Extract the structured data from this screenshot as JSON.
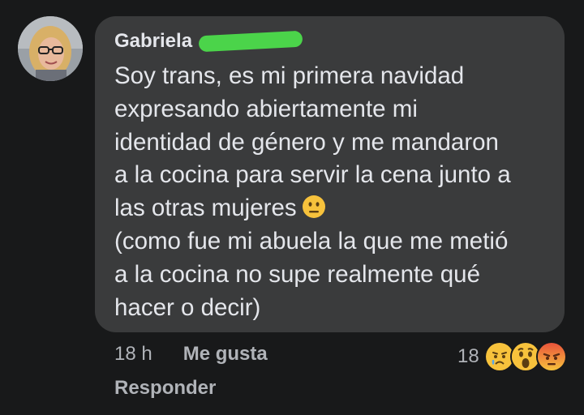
{
  "comment": {
    "author": "Gabriela",
    "lines": [
      "Soy trans, es mi primera navidad",
      "expresando abiertamente mi",
      "identidad de género y me mandaron",
      "a la cocina para servir la cena junto a",
      "las otras mujeres",
      "(como fue mi abuela la que me metió",
      "a la cocina no supe realmente qué",
      "hacer o decir)"
    ],
    "inline_emoji": "neutral-face-emoji",
    "timestamp": "18 h",
    "like_label": "Me gusta",
    "reply_label": "Responder",
    "reaction_count": "18",
    "reaction_icons": [
      "sad-reaction-icon",
      "wow-reaction-icon",
      "angry-reaction-icon"
    ]
  },
  "colors": {
    "background": "#18191a",
    "bubble": "#3a3b3c",
    "text": "#e4e6eb",
    "meta_text": "#b0b3b8",
    "redaction_mark": "#4bd44a"
  }
}
